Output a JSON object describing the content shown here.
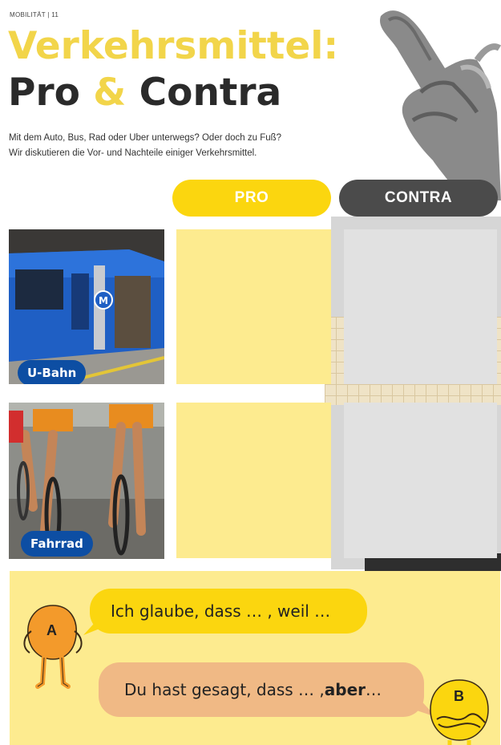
{
  "header": {
    "section_label": "MOBILITÄT | 11",
    "title_line1": "Verkehrsmittel:",
    "title_pro": "Pro",
    "title_amp": "&",
    "title_contra": "Contra",
    "subtitle_line1": "Mit dem Auto, Bus, Rad oder Uber unterwegs? Oder doch zu Fuß?",
    "subtitle_line2": "Wir diskutieren die Vor- und Nachteile einiger Verkehrsmittel."
  },
  "columns": {
    "pro": "PRO",
    "contra": "CONTRA"
  },
  "rows": [
    {
      "label": "U-Bahn"
    },
    {
      "label": "Fahrrad"
    }
  ],
  "dialogue": {
    "speaker_a": "A",
    "speaker_b": "B",
    "bubble_a": "Ich glaube, dass … , weil …",
    "bubble_b_pre": "Du hast gesagt, dass … , ",
    "bubble_b_bold": "aber",
    "bubble_b_post": "…"
  },
  "colors": {
    "yellow_title": "#f2d54a",
    "pro_pill": "#fbd60f",
    "contra_pill": "#4b4b4b",
    "pro_cell": "#fdeb8f",
    "contra_cell": "#e1e1e1",
    "badge_blue": "#0d4ea3",
    "bubble_b": "#f0b985",
    "character_a": "#f39a2b",
    "character_b": "#fbd60f"
  }
}
